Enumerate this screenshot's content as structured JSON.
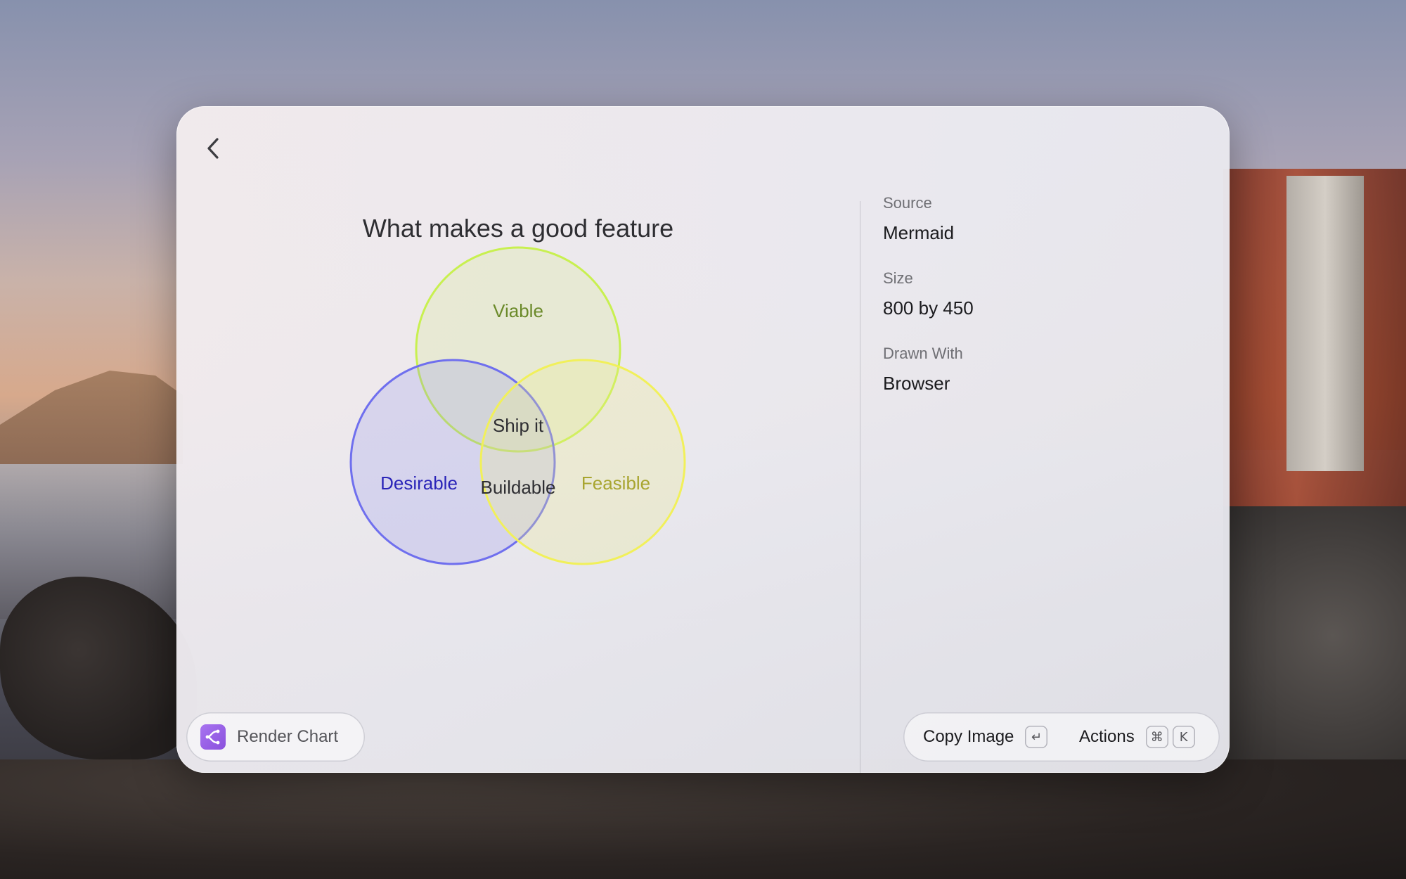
{
  "chart": {
    "title": "What makes a good feature",
    "sets": [
      {
        "label": "Viable",
        "color": "#c8f050",
        "text_color": "#6b8a2a"
      },
      {
        "label": "Desirable",
        "color": "#6f6fee",
        "text_color": "#2a24b8"
      },
      {
        "label": "Feasible",
        "color": "#f1f05a",
        "text_color": "#a8a530"
      }
    ],
    "intersections": {
      "viable_desirable_feasible": "Ship it",
      "desirable_feasible": "Buildable"
    }
  },
  "meta": {
    "source_label": "Source",
    "source_value": "Mermaid",
    "size_label": "Size",
    "size_value": "800 by 450",
    "drawn_label": "Drawn With",
    "drawn_value": "Browser"
  },
  "footer": {
    "render_label": "Render Chart",
    "copy_label": "Copy Image",
    "copy_key": "↵",
    "actions_label": "Actions",
    "actions_keys": [
      "⌘",
      "K"
    ]
  },
  "icons": {
    "back": "chevron-left-icon",
    "render": "render-chart-icon",
    "enter": "enter-key-icon",
    "command": "command-key-icon"
  }
}
